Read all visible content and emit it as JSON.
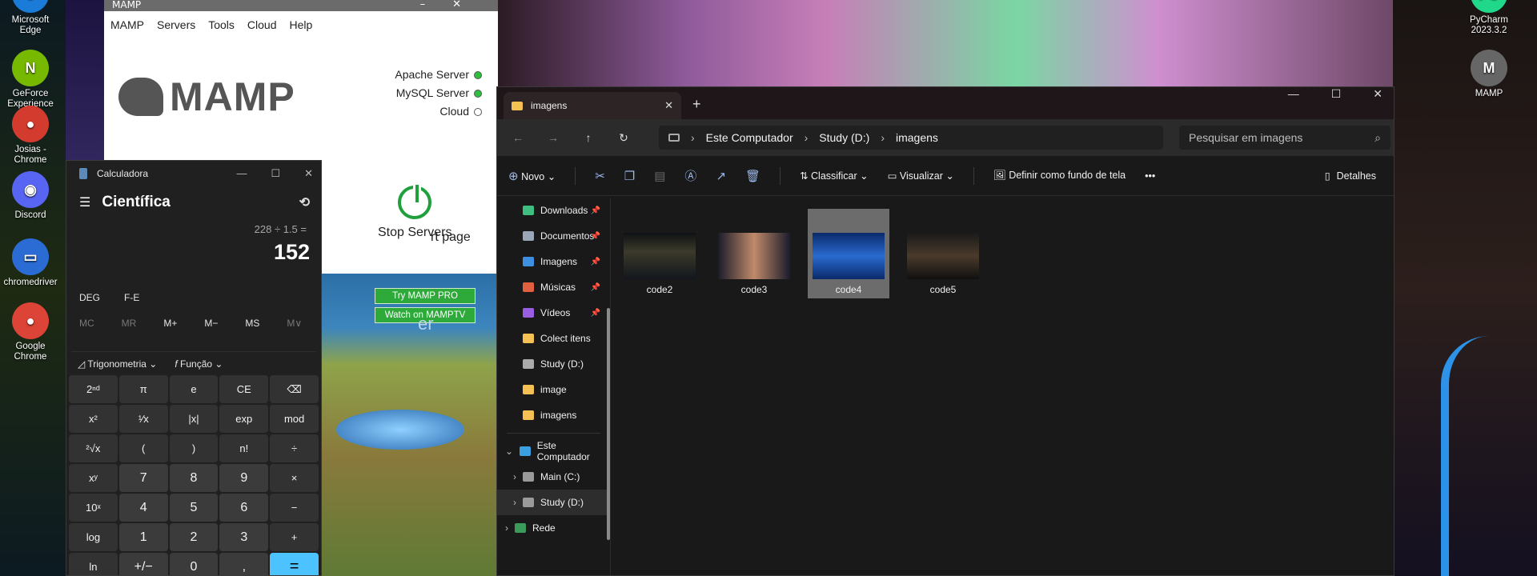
{
  "desktop": {
    "icons": [
      {
        "label": "Microsoft Edge",
        "glyph": "e",
        "color": "#1b7bd9"
      },
      {
        "label": "GeForce Experience",
        "glyph": "N",
        "color": "#76b900"
      },
      {
        "label": "Josias - Chrome",
        "glyph": "●",
        "color": "#d33b2f"
      },
      {
        "label": "Discord",
        "glyph": "◉",
        "color": "#5865f2"
      },
      {
        "label": "chromedriver",
        "glyph": "▭",
        "color": "#2b6cd4"
      },
      {
        "label": "Google Chrome",
        "glyph": "●",
        "color": "#db4437"
      }
    ],
    "right_icons": [
      {
        "label": "PyCharm 2023.3.2",
        "glyph": "PC",
        "color": "#21d789"
      },
      {
        "label": "MAMP",
        "glyph": "M",
        "color": "#666"
      }
    ]
  },
  "mamp": {
    "title": "MAMP",
    "menu": [
      "MAMP",
      "Servers",
      "Tools",
      "Cloud",
      "Help"
    ],
    "logo_text": "MAMP",
    "servers": [
      {
        "label": "Apache Server",
        "status_color": "#2fbf3f"
      },
      {
        "label": "MySQL Server",
        "status_color": "#2fbf3f"
      },
      {
        "label": "Cloud",
        "status_color": "#ffffff"
      }
    ],
    "start_page_partial": "rt page",
    "stop_label": "Stop Servers",
    "try_pro": "Try MAMP PRO",
    "watch": "Watch on MAMPTV",
    "banner_partial": "er"
  },
  "calculator": {
    "title": "Calculadora",
    "mode": "Científica",
    "expression": "228 ÷ 1.5 =",
    "result": "152",
    "angle": [
      "DEG",
      "F-E"
    ],
    "memory": [
      "MC",
      "MR",
      "M+",
      "M−",
      "MS",
      "M∨"
    ],
    "trig_label": "Trigonometria",
    "func_label": "Função",
    "keys": [
      [
        "2ⁿᵈ",
        "π",
        "e",
        "CE",
        "⌫"
      ],
      [
        "x²",
        "¹⁄x",
        "|x|",
        "exp",
        "mod"
      ],
      [
        "²√x",
        "(",
        ")",
        "n!",
        "÷"
      ],
      [
        "xʸ",
        "7",
        "8",
        "9",
        "×"
      ],
      [
        "10ˣ",
        "4",
        "5",
        "6",
        "−"
      ],
      [
        "log",
        "1",
        "2",
        "3",
        "+"
      ],
      [
        "ln",
        "+/−",
        "0",
        ",",
        "="
      ]
    ]
  },
  "explorer": {
    "tab_title": "imagens",
    "breadcrumb": [
      "Este Computador",
      "Study (D:)",
      "imagens"
    ],
    "search_placeholder": "Pesquisar em imagens",
    "commands": {
      "new": "Novo",
      "sort": "Classificar",
      "view": "Visualizar",
      "wallpaper": "Definir como fundo de tela",
      "details": "Detalhes"
    },
    "nav_items": [
      {
        "label": "Downloads",
        "pinned": true,
        "color": "#3fbf7f"
      },
      {
        "label": "Documentos",
        "pinned": true,
        "color": "#9aa7b8"
      },
      {
        "label": "Imagens",
        "pinned": true,
        "color": "#3f8fe0"
      },
      {
        "label": "Músicas",
        "pinned": true,
        "color": "#e0603f"
      },
      {
        "label": "Vídeos",
        "pinned": true,
        "color": "#9a5fe0"
      },
      {
        "label": "Colect itens",
        "pinned": false,
        "color": "#f3c252"
      },
      {
        "label": "Study (D:)",
        "pinned": false,
        "color": "#aaaaaa"
      },
      {
        "label": "image",
        "pinned": false,
        "color": "#f3c252"
      },
      {
        "label": "imagens",
        "pinned": false,
        "color": "#f3c252"
      }
    ],
    "tree": [
      {
        "label": "Este Computador",
        "expanded": true
      },
      {
        "label": "Main (C:)",
        "expanded": false
      },
      {
        "label": "Study (D:)",
        "expanded": false,
        "selected": true
      },
      {
        "label": "Rede",
        "expanded": false
      }
    ],
    "files": [
      {
        "name": "code2",
        "selected": false
      },
      {
        "name": "code3",
        "selected": false
      },
      {
        "name": "code4",
        "selected": true
      },
      {
        "name": "code5",
        "selected": false
      }
    ]
  }
}
